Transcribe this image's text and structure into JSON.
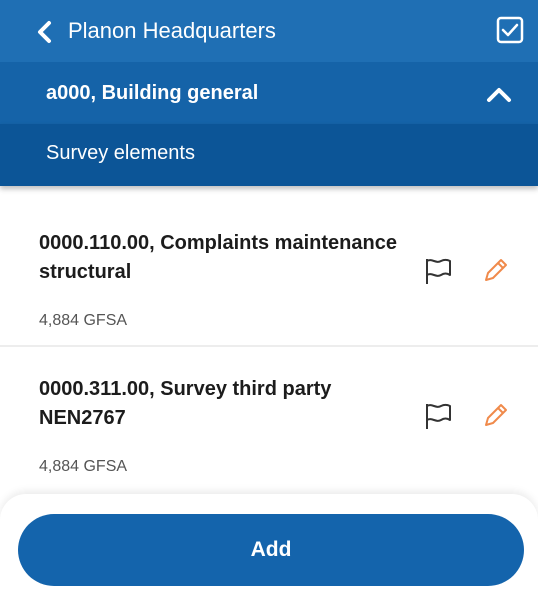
{
  "header": {
    "title": "Planon Headquarters",
    "back_icon": "chevron-left-icon",
    "action_icon": "checkbox-checked-icon"
  },
  "section": {
    "title": "a000, Building general",
    "toggle_icon": "chevron-up-icon"
  },
  "subheader": {
    "title": "Survey elements"
  },
  "items": [
    {
      "title": "0000.110.00, Complaints maintenance structural",
      "subtitle": "4,884 GFSA",
      "icons": [
        "flag-icon",
        "pencil-icon"
      ]
    },
    {
      "title": "0000.311.00, Survey third party NEN2767",
      "subtitle": "4,884 GFSA",
      "icons": [
        "flag-icon",
        "pencil-icon"
      ]
    }
  ],
  "footer": {
    "add_label": "Add"
  },
  "colors": {
    "header_bg": "#1f6fb4",
    "section_bg": "#1563a8",
    "subheader_bg": "#0c5597",
    "button_bg": "#1464ac",
    "edit_accent": "#f08a4b"
  }
}
